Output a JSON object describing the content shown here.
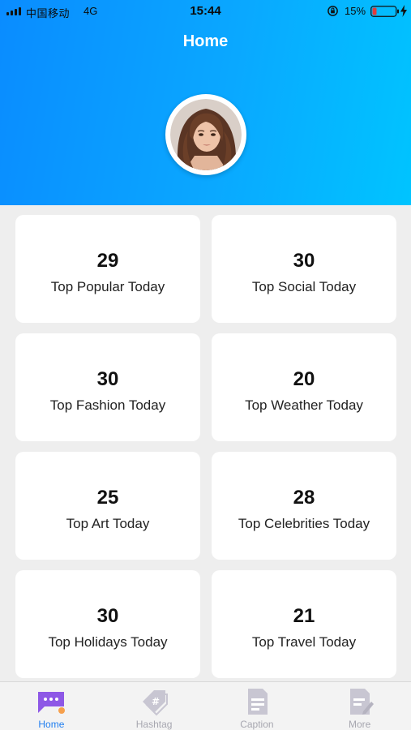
{
  "status_bar": {
    "carrier": "中国移动",
    "network": "4G",
    "time": "15:44",
    "battery_percent": "15%"
  },
  "header": {
    "title": "Home"
  },
  "colors": {
    "header_gradient_start": "#0a8cff",
    "header_gradient_end": "#00c4ff",
    "tab_active": "#1f7ef0",
    "tab_inactive": "#a7a7b0"
  },
  "cards": [
    {
      "count": "29",
      "label": "Top Popular Today"
    },
    {
      "count": "30",
      "label": "Top Social Today"
    },
    {
      "count": "30",
      "label": "Top Fashion Today"
    },
    {
      "count": "20",
      "label": "Top Weather Today"
    },
    {
      "count": "25",
      "label": "Top Art Today"
    },
    {
      "count": "28",
      "label": "Top Celebrities Today"
    },
    {
      "count": "30",
      "label": "Top Holidays Today"
    },
    {
      "count": "21",
      "label": "Top Travel Today"
    }
  ],
  "tabs": [
    {
      "label": "Home",
      "icon": "chat-bubble-icon",
      "active": true
    },
    {
      "label": "Hashtag",
      "icon": "hashtag-tag-icon",
      "active": false
    },
    {
      "label": "Caption",
      "icon": "document-icon",
      "active": false
    },
    {
      "label": "More",
      "icon": "edit-document-icon",
      "active": false
    }
  ]
}
